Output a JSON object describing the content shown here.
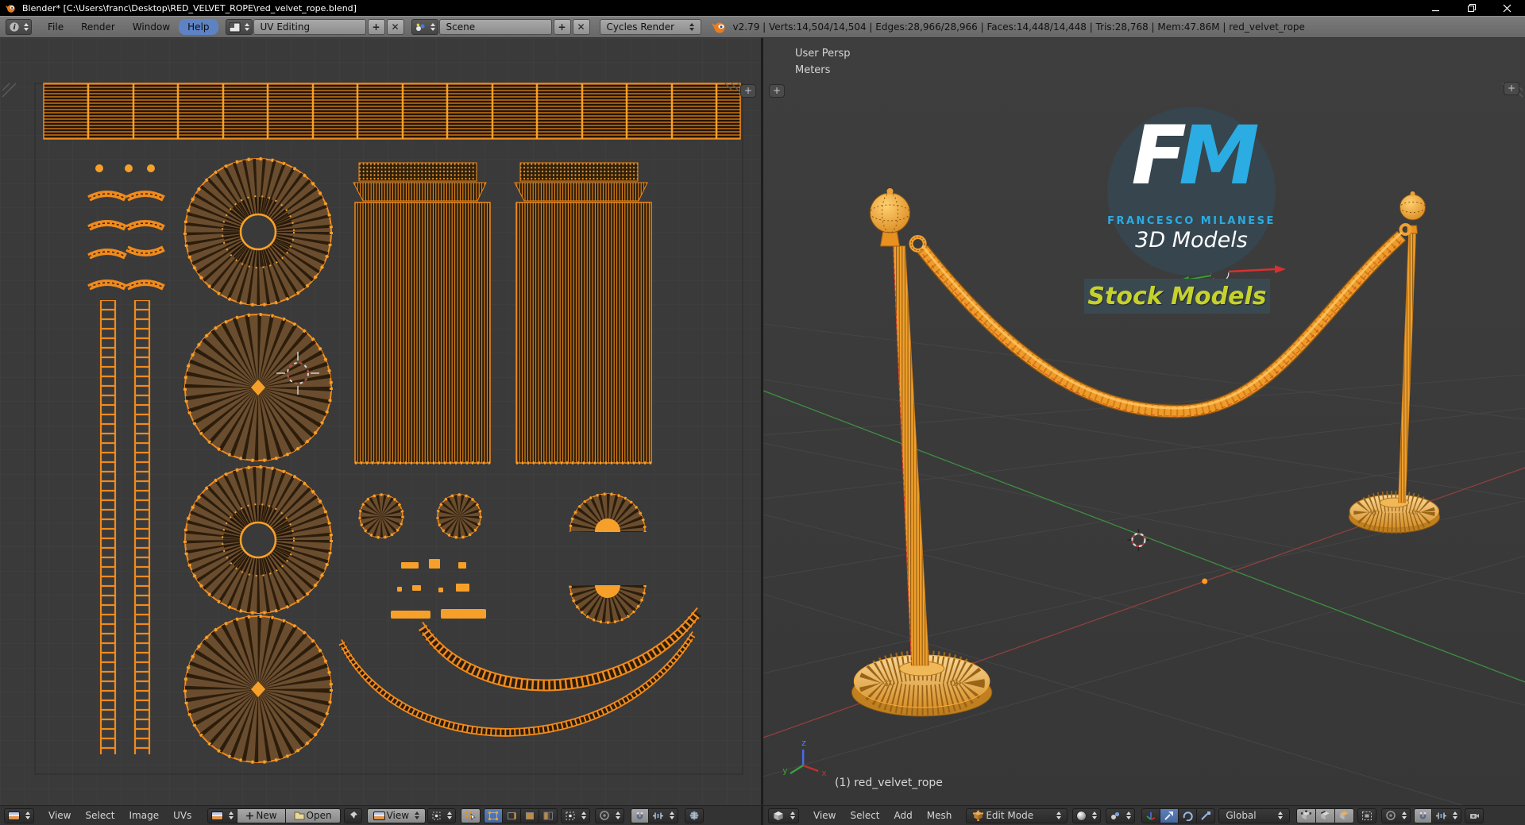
{
  "window": {
    "title": "Blender* [C:\\Users\\franc\\Desktop\\RED_VELVET_ROPE\\red_velvet_rope.blend]"
  },
  "info_bar": {
    "menus": {
      "file": "File",
      "render": "Render",
      "window": "Window",
      "help": "Help"
    },
    "layout_field": "UV Editing",
    "scene_field": "Scene",
    "engine_field": "Cycles Render",
    "stats": "v2.79 | Verts:14,504/14,504 | Edges:28,966/28,966 | Faces:14,448/14,448 | Tris:28,768 | Mem:47.86M | red_velvet_rope"
  },
  "uv_editor": {
    "header": {
      "view": "View",
      "select": "Select",
      "image": "Image",
      "uvs": "UVs",
      "new": "New",
      "open": "Open",
      "view_mode": "View"
    }
  },
  "viewport": {
    "view_name": "User Persp",
    "units": "Meters",
    "object_info": "(1) red_velvet_rope",
    "gizmo": {
      "x": "x",
      "y": "y",
      "z": "z"
    },
    "header": {
      "view": "View",
      "select": "Select",
      "add": "Add",
      "mesh": "Mesh",
      "mode": "Edit Mode",
      "orientation": "Global"
    }
  },
  "logo": {
    "initial_f": "F",
    "initial_m": "M",
    "name": "FRANCESCO MILANESE",
    "tagline": "3D Models",
    "banner": "Stock Models"
  },
  "colors": {
    "uv_accent": "#f7a029",
    "selection_blue": "#4f76b3",
    "axis_x": "#b03a3a",
    "axis_y": "#3f8f3f",
    "axis_z": "#4a6ae8",
    "logo_blue": "#2bace2",
    "logo_yellow": "#c6d22c"
  }
}
